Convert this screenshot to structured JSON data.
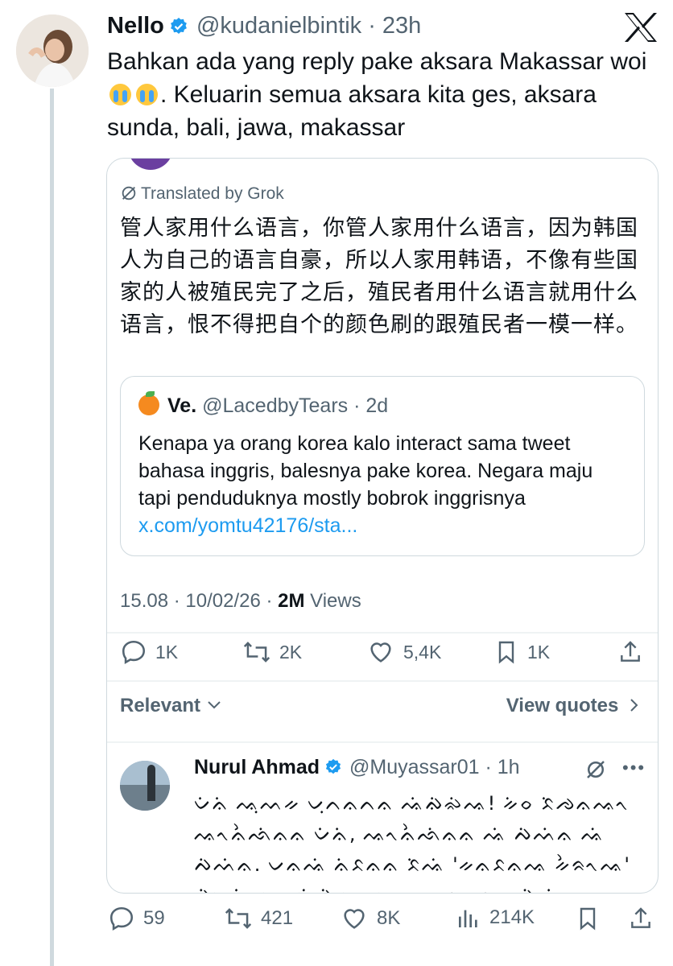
{
  "tweet": {
    "author_name": "Nello",
    "author_handle": "@kudanielbintik",
    "time": "23h",
    "text_1": "Bahkan ada yang reply pake aksara Makassar woi",
    "text_2": ". Keluarin semua aksara kita ges, aksara sunda, bali, jawa, makassar"
  },
  "quoted": {
    "translated_by": "Translated by Grok",
    "translation": "管人家用什么语言，你管人家用什么语言，因为韩国人为自己的语言自豪，所以人家用韩语，不像有些国家的人被殖民完了之后，殖民者用什么语言就用什么语言，恨不得把自个的颜色刷的跟殖民者一模一样。",
    "inner": {
      "name": "Ve.",
      "handle": "@LacedbyTears",
      "time": "2d",
      "text": "Kenapa ya orang korea kalo interact sama tweet bahasa inggris, balesnya pake korea. Negara maju tapi penduduknya mostly bobrok inggrisnya ",
      "link": "x.com/yomtu42176/sta..."
    },
    "meta": {
      "timestamp": "15.08 · 10/02/26 · ",
      "views_count": "2M",
      "views_label": " Views"
    },
    "actions": {
      "replies": "1K",
      "reposts": "2K",
      "likes": "5,4K",
      "bookmarks": "1K"
    },
    "sort_label": "Relevant",
    "view_quotes": "View quotes",
    "reply": {
      "name": "Nurul Ahmad",
      "handle": "@Muyassar01",
      "time": "1h",
      "text": "ᨆᨗᨊᨗ ᨕᨘᨓᨀ ᨆᨘᨈᨊᨈᨊ ᨕᨗᨁᨗᨋᨗᨕ! ᨀᨗᨔ ᨅᨗᨌᨊᨕᨚ ᨕᨚᨊᨛᨒᨗᨊᨊ ᨆᨗᨊᨗ, ᨕᨚᨊᨛᨒᨗᨊᨊ ᨕᨗ ᨄᨗᨓᨗᨊ ᨕᨗ ᨄᨗᨓᨗᨊ. ᨆᨊᨕᨗ ᨊᨗᨅᨊᨊ ᨅᨗᨕᨗ 'ᨀᨊᨅᨊᨕ ᨀᨛᨑᨚᨕ' ᨄᨗᨆᨊᨗ, ᨆᨊᨆᨗᨄᨗ ᨆᨊᨆᨊᨕ ᨀᨊᨀᨊ ᨄᨗᨓᨗᨊ ᨙᨄᨊᨕ ᨕᨚᨓᨗ ᨆᨊᨆᨊᨕ?"
    }
  },
  "bottom_actions": {
    "replies": "59",
    "reposts": "421",
    "likes": "8K",
    "views": "214K"
  },
  "colors": {
    "link": "#1d9bf0",
    "muted": "#536471",
    "verified": "#1d9bf0",
    "border": "#cfd9de"
  },
  "icons": [
    "x-logo-icon",
    "verified-badge-icon",
    "grok-translate-icon",
    "reply-icon",
    "repost-icon",
    "like-icon",
    "bookmark-icon",
    "share-icon",
    "chevron-down-icon",
    "chevron-right-icon",
    "more-icon",
    "views-icon"
  ]
}
